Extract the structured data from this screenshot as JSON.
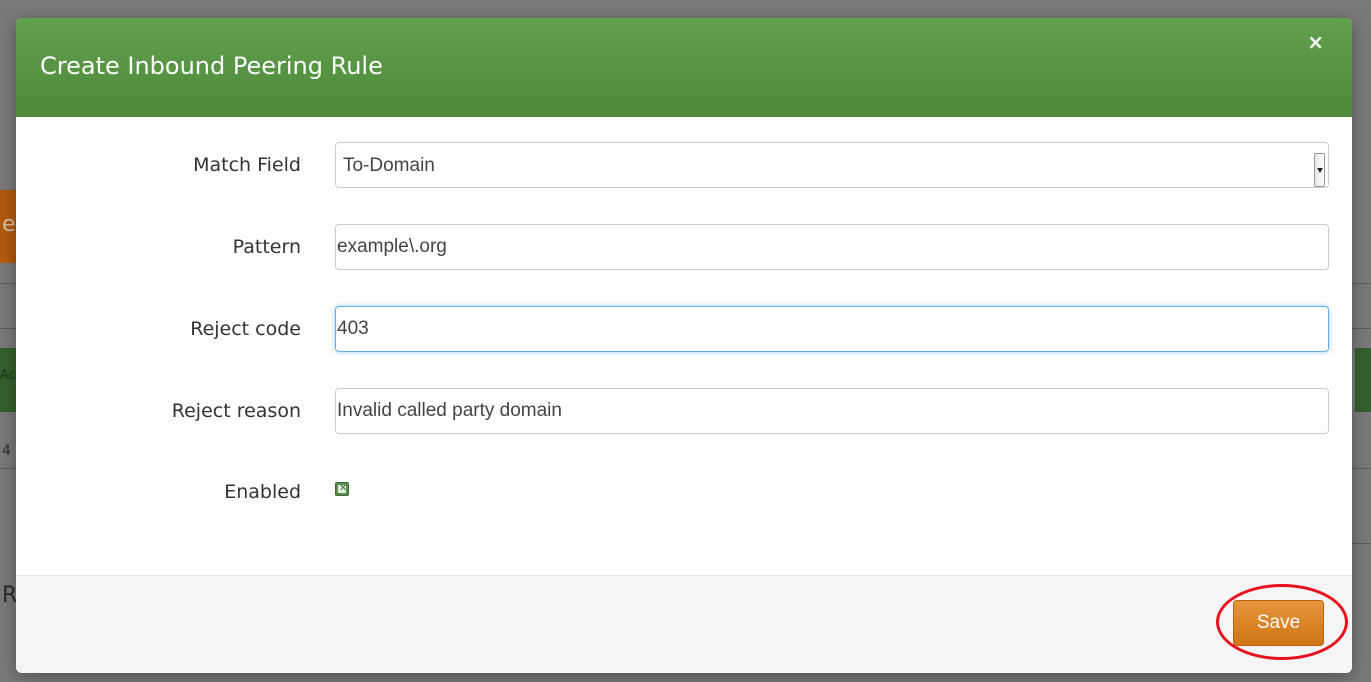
{
  "modal": {
    "title": "Create Inbound Peering Rule",
    "close_symbol": "×"
  },
  "form": {
    "match_field": {
      "label": "Match Field",
      "selected": "To-Domain"
    },
    "pattern": {
      "label": "Pattern",
      "value": "example\\.org"
    },
    "reject_code": {
      "label": "Reject code",
      "value": "403"
    },
    "reject_reason": {
      "label": "Reject reason",
      "value": "Invalid called party domain"
    },
    "enabled": {
      "label": "Enabled",
      "checked": true
    }
  },
  "footer": {
    "save_label": "Save"
  },
  "background": {
    "fragment_1": "e",
    "fragment_2": "Ac",
    "fragment_3": "4",
    "fragment_4": "R"
  },
  "colors": {
    "header_green": "#57963f",
    "save_orange": "#dc8429",
    "highlight_red": "#e8101c",
    "focus_blue": "#66afe9"
  }
}
